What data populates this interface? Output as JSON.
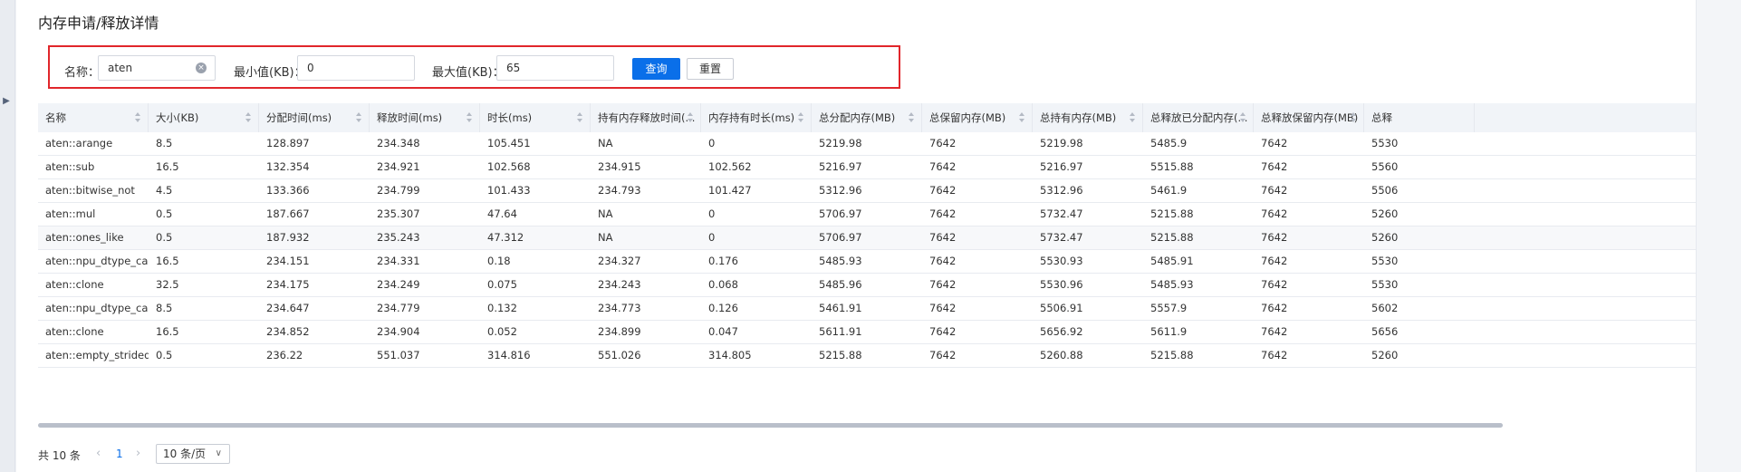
{
  "page": {
    "title": "内存申请/释放详情"
  },
  "filters": {
    "name_label": "名称：",
    "name_value": "aten",
    "min_label": "最小值(KB)：",
    "min_value": "0",
    "max_label": "最大值(KB)：",
    "max_value": "65",
    "query_button": "查询",
    "reset_button": "重置"
  },
  "table": {
    "columns": [
      "名称",
      "大小(KB)",
      "分配时间(ms)",
      "释放时间(ms)",
      "时长(ms)",
      "持有内存释放时间(...",
      "内存持有时长(ms)",
      "总分配内存(MB)",
      "总保留内存(MB)",
      "总持有内存(MB)",
      "总释放已分配内存(...",
      "总释放保留内存(MB)",
      "总释"
    ],
    "rows": [
      [
        "aten::arange",
        "8.5",
        "128.897",
        "234.348",
        "105.451",
        "NA",
        "0",
        "5219.98",
        "7642",
        "5219.98",
        "5485.9",
        "7642",
        "5530"
      ],
      [
        "aten::sub",
        "16.5",
        "132.354",
        "234.921",
        "102.568",
        "234.915",
        "102.562",
        "5216.97",
        "7642",
        "5216.97",
        "5515.88",
        "7642",
        "5560"
      ],
      [
        "aten::bitwise_not",
        "4.5",
        "133.366",
        "234.799",
        "101.433",
        "234.793",
        "101.427",
        "5312.96",
        "7642",
        "5312.96",
        "5461.9",
        "7642",
        "5506"
      ],
      [
        "aten::mul",
        "0.5",
        "187.667",
        "235.307",
        "47.64",
        "NA",
        "0",
        "5706.97",
        "7642",
        "5732.47",
        "5215.88",
        "7642",
        "5260"
      ],
      [
        "aten::ones_like",
        "0.5",
        "187.932",
        "235.243",
        "47.312",
        "NA",
        "0",
        "5706.97",
        "7642",
        "5732.47",
        "5215.88",
        "7642",
        "5260"
      ],
      [
        "aten::npu_dtype_cast",
        "16.5",
        "234.151",
        "234.331",
        "0.18",
        "234.327",
        "0.176",
        "5485.93",
        "7642",
        "5530.93",
        "5485.91",
        "7642",
        "5530"
      ],
      [
        "aten::clone",
        "32.5",
        "234.175",
        "234.249",
        "0.075",
        "234.243",
        "0.068",
        "5485.96",
        "7642",
        "5530.96",
        "5485.93",
        "7642",
        "5530"
      ],
      [
        "aten::npu_dtype_cast",
        "8.5",
        "234.647",
        "234.779",
        "0.132",
        "234.773",
        "0.126",
        "5461.91",
        "7642",
        "5506.91",
        "5557.9",
        "7642",
        "5602"
      ],
      [
        "aten::clone",
        "16.5",
        "234.852",
        "234.904",
        "0.052",
        "234.899",
        "0.047",
        "5611.91",
        "7642",
        "5656.92",
        "5611.9",
        "7642",
        "5656"
      ],
      [
        "aten::empty_strided",
        "0.5",
        "236.22",
        "551.037",
        "314.816",
        "551.026",
        "314.805",
        "5215.88",
        "7642",
        "5260.88",
        "5215.88",
        "7642",
        "5260"
      ]
    ]
  },
  "pagination": {
    "total": "共 10 条",
    "current_page": "1",
    "page_size": "10 条/页"
  }
}
